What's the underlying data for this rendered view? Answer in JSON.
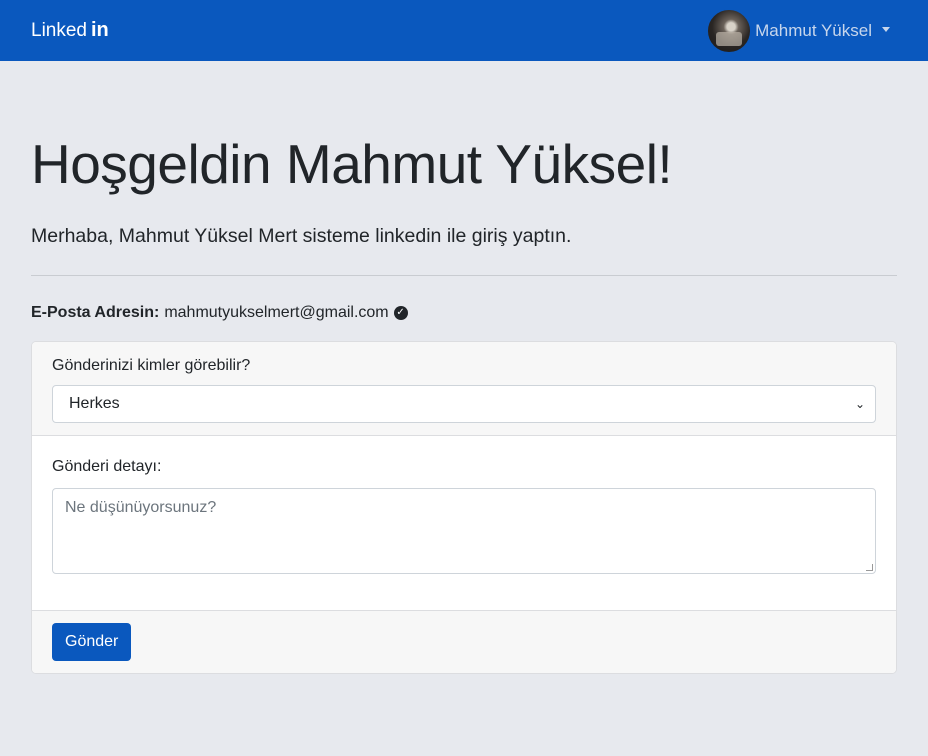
{
  "navbar": {
    "brand_text": "Linked",
    "brand_in": "in",
    "user_name": "Mahmut Yüksel",
    "brand_color": "#0a58be"
  },
  "main": {
    "title": "Hoşgeldin Mahmut Yüksel!",
    "lead": "Merhaba, Mahmut Yüksel Mert sisteme linkedin ile giriş yaptın.",
    "email_label": "E-Posta Adresin:",
    "email_value": "mahmutyukselmert@gmail.com",
    "email_verified_icon": "check-circle-icon"
  },
  "form": {
    "visibility_label": "Gönderinizi kimler görebilir?",
    "visibility_selected": "Herkes",
    "detail_label": "Gönderi detayı:",
    "detail_placeholder": "Ne düşünüyorsunuz?",
    "detail_value": "",
    "submit_label": "Gönder"
  }
}
